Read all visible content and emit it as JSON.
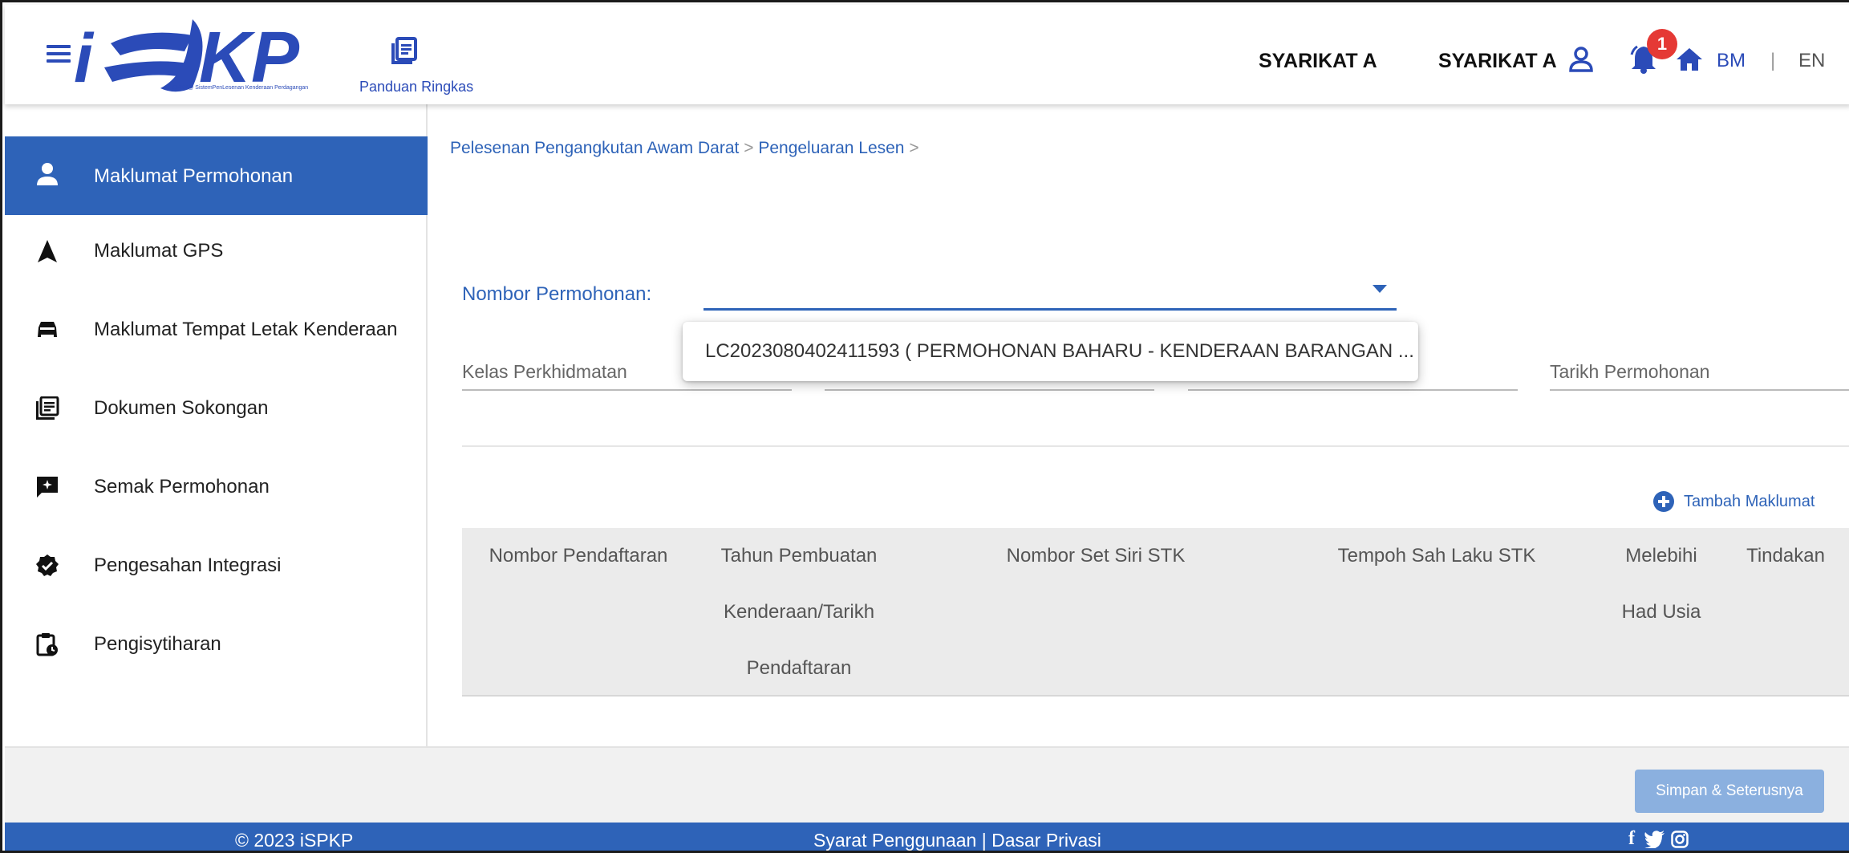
{
  "header": {
    "logo_text": "iSPKP",
    "logo_subtext": "iSPKP@ SistemPenLesenan Kenderaan Perdagangan",
    "panduan_label": "Panduan Ringkas",
    "company_name_1": "SYARIKAT A",
    "company_name_2": "SYARIKAT A",
    "notification_count": "1",
    "lang_bm": "BM",
    "lang_separator": "|",
    "lang_en": "EN",
    "accent_color": "#2e63b8"
  },
  "sidebar": {
    "items": [
      {
        "label": "Maklumat Permohonan",
        "icon": "person-icon",
        "active": true
      },
      {
        "label": "Maklumat GPS",
        "icon": "navigation-arrow-icon"
      },
      {
        "label": "Maklumat Tempat Letak Kenderaan",
        "icon": "car-icon"
      },
      {
        "label": "Dokumen Sokongan",
        "icon": "document-library-icon"
      },
      {
        "label": "Semak Permohonan",
        "icon": "review-chat-icon"
      },
      {
        "label": "Pengesahan Integrasi",
        "icon": "verified-badge-icon"
      },
      {
        "label": "Pengisytiharan",
        "icon": "clipboard-clock-icon"
      }
    ]
  },
  "main": {
    "breadcrumb": {
      "item1": "Pelesenan Pengangkutan Awam Darat",
      "item2": "Pengeluaran Lesen",
      "separator": ">"
    },
    "nombor_permohonan_label": "Nombor Permohonan:",
    "dropdown_option": "LC2023080402411593 ( PERMOHONAN BAHARU - KENDERAAN BARANGAN ...",
    "fields": {
      "kelas_perkhidmatan": "Kelas Perkhidmatan",
      "tarikh_permohonan": "Tarikh Permohonan"
    },
    "tambah_label": "Tambah Maklumat",
    "table": {
      "headers": [
        [
          "Nombor Pendaftaran"
        ],
        [
          "Tahun Pembuatan",
          "Kenderaan/Tarikh",
          "Pendaftaran"
        ],
        [
          "Nombor Set Siri STK"
        ],
        [
          "Tempoh Sah Laku STK"
        ],
        [
          "Melebihi",
          "Had Usia"
        ],
        [
          "Tindakan"
        ]
      ]
    }
  },
  "actions": {
    "simpan_label": "Simpan & Seterusnya"
  },
  "footer": {
    "copyright": "© 2023 iSPKP",
    "terms": "Syarat Penggunaan",
    "terms_separator": "|",
    "privacy": "Dasar Privasi",
    "social_facebook": "f",
    "social_twitter": "twitter",
    "social_instagram": "instagram"
  }
}
